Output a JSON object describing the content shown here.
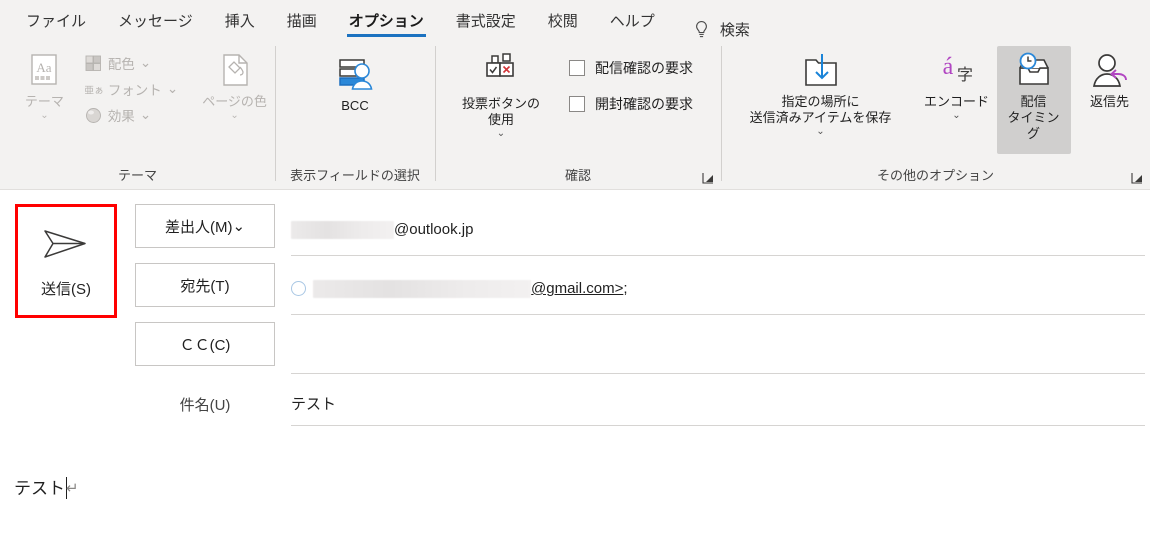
{
  "ribbon": {
    "tabs": [
      {
        "label": "ファイル",
        "active": false
      },
      {
        "label": "メッセージ",
        "active": false
      },
      {
        "label": "挿入",
        "active": false
      },
      {
        "label": "描画",
        "active": false
      },
      {
        "label": "オプション",
        "active": true
      },
      {
        "label": "書式設定",
        "active": false
      },
      {
        "label": "校閲",
        "active": false
      },
      {
        "label": "ヘルプ",
        "active": false
      }
    ],
    "search": {
      "icon": "lightbulb-icon",
      "label": "検索"
    },
    "accent_color": "#1b72c0",
    "groups": [
      {
        "id": "theme",
        "label": "テーマ",
        "disabled": true,
        "has_dialog_launcher": false,
        "buttons": [
          {
            "id": "themes",
            "label": "テーマ",
            "icon": "theme-aa-icon",
            "caret": "⌄",
            "disabled": true
          },
          {
            "id": "page-color",
            "label": "ページの色",
            "icon": "page-color-icon",
            "caret": "⌄",
            "disabled": true
          }
        ],
        "small_items": [
          {
            "id": "colors",
            "label": "配色",
            "icon": "color-palette-icon",
            "caret": "⌄"
          },
          {
            "id": "fonts",
            "label": "フォント",
            "icon": "font-aa-icon",
            "caret": "⌄"
          },
          {
            "id": "effects",
            "label": "効果",
            "icon": "effects-sphere-icon",
            "caret": "⌄"
          }
        ]
      },
      {
        "id": "show-fields",
        "label": "表示フィールドの選択",
        "disabled": false,
        "has_dialog_launcher": false,
        "buttons": [
          {
            "id": "bcc",
            "label": "BCC",
            "icon": "bcc-icon",
            "caret": "",
            "disabled": false
          }
        ]
      },
      {
        "id": "tracking",
        "label": "確認",
        "disabled": false,
        "has_dialog_launcher": true,
        "buttons": [
          {
            "id": "use-voting-buttons",
            "label": "投票ボタンの\n使用",
            "icon": "voting-buttons-icon",
            "caret": "⌄",
            "disabled": false
          }
        ],
        "checkboxes": [
          {
            "id": "request-delivery-receipt",
            "label": "配信確認の要求",
            "checked": false
          },
          {
            "id": "request-read-receipt",
            "label": "開封確認の要求",
            "checked": false
          }
        ]
      },
      {
        "id": "more-options",
        "label": "その他のオプション",
        "disabled": false,
        "has_dialog_launcher": true,
        "buttons": [
          {
            "id": "save-sent-item-to",
            "label": "指定の場所に\n送信済みアイテムを保存",
            "icon": "save-to-folder-icon",
            "caret": "⌄",
            "disabled": false,
            "caret_inline": true
          },
          {
            "id": "encoding",
            "label": "エンコード",
            "icon": "encoding-a-icon",
            "caret": "⌄",
            "disabled": false
          },
          {
            "id": "delay-delivery",
            "label": "配信\nタイミング",
            "icon": "delay-delivery-clock-icon",
            "caret": "",
            "disabled": false,
            "hovered": true
          },
          {
            "id": "direct-replies-to",
            "label": "返信先",
            "icon": "reply-person-icon",
            "caret": "",
            "disabled": false
          }
        ]
      }
    ]
  },
  "compose": {
    "send_button": {
      "label": "送信(S)",
      "icon": "send-arrow-icon",
      "annotated": true,
      "annotation_color": "#ff0000"
    },
    "fields": [
      {
        "id": "from",
        "button_label": "差出人(M)",
        "has_caret": true,
        "value_redacted": true,
        "value_suffix": "@outlook.jp",
        "redact_width": 103
      },
      {
        "id": "to",
        "button_label": "宛先(T)",
        "has_caret": false,
        "value_redacted": true,
        "value_suffix": "@gmail.com>",
        "value_trailing": " ;",
        "redact_width": 218,
        "has_presence_dot": true,
        "underlined": true
      },
      {
        "id": "cc",
        "button_label": "ＣＣ(C)",
        "has_caret": false,
        "value_redacted": false,
        "value_suffix": ""
      }
    ],
    "subject": {
      "label": "件名(U)",
      "value": "テスト"
    }
  },
  "body": {
    "text": "テスト",
    "paragraph_mark": "↵"
  }
}
